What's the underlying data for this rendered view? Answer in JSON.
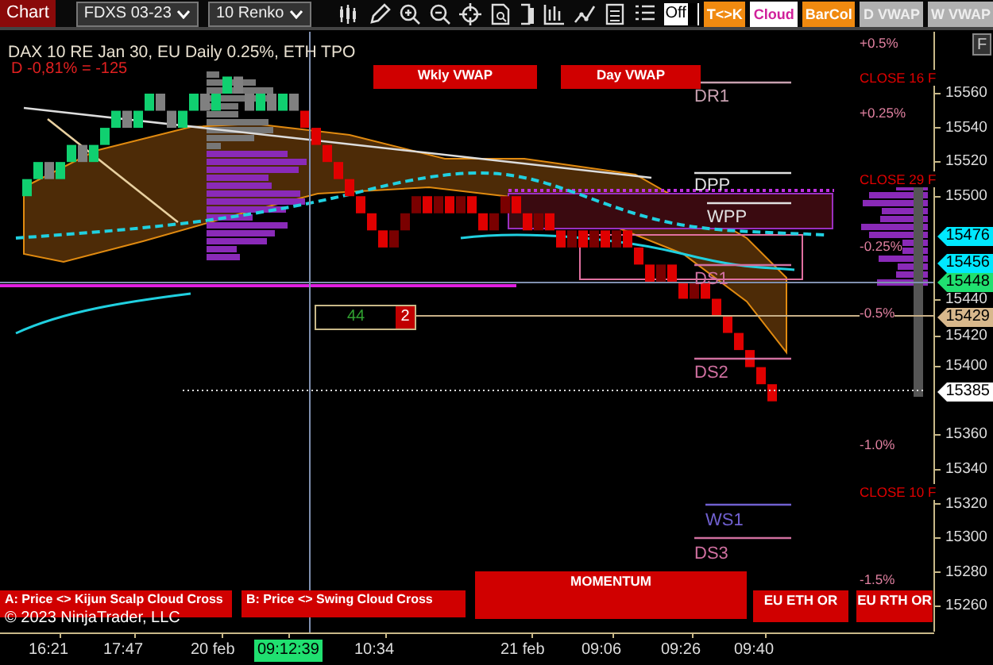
{
  "toolbar": {
    "tab": "Chart",
    "instrument": "FDXS 03-23",
    "bar_type": "10 Renko",
    "toggle": {
      "label": "Off",
      "on": false
    },
    "buttons": [
      {
        "label": "T<>K",
        "kind": "orange"
      },
      {
        "label": "Cloud",
        "kind": "white"
      },
      {
        "label": "BarCol",
        "kind": "orange"
      },
      {
        "label": "D VWAP",
        "kind": "grey"
      },
      {
        "label": "W VWAP",
        "kind": "grey"
      }
    ]
  },
  "chart": {
    "title": "DAX 10  RE Jan 30, EU Daily 0.25%, ETH TPO",
    "change": "D -0,81% = -125",
    "vwap_buttons": [
      "Wkly VWAP",
      "Day VWAP"
    ],
    "pivot_labels": [
      {
        "label": "DR1",
        "color": "#c8a0b0"
      },
      {
        "label": "DPP",
        "color": "#e0e0e0"
      },
      {
        "label": "WPP",
        "color": "#e0e0e0"
      },
      {
        "label": "DS1",
        "color": "#d070a0"
      },
      {
        "label": "DS2",
        "color": "#d070a0"
      },
      {
        "label": "WS1",
        "color": "#7060d0"
      },
      {
        "label": "DS3",
        "color": "#d070a0"
      }
    ],
    "percent_labels": [
      "+0.5%",
      "+0.25%",
      "-0.25%",
      "-0.5%",
      "-1.0%",
      "-1.5%"
    ],
    "close_labels": [
      "CLOSE 16 F",
      "CLOSE 29 F",
      "CLOSE 10 F"
    ],
    "counter": {
      "value": "44",
      "badge": "2"
    },
    "signal_buttons": [
      "A: Price <> Kijun Scalp Cloud Cross",
      "B: Price <> Swing Cloud Cross"
    ],
    "momentum": "MOMENTUM",
    "session_buttons": [
      "EU ETH OR",
      "EU RTH OR"
    ],
    "copyright": "© 2023 NinjaTrader, LLC",
    "corner_button": "F",
    "price_axis": {
      "ticks": [
        "15560",
        "15540",
        "15520",
        "15500",
        "15440",
        "15420",
        "15400",
        "15360",
        "15340",
        "15320",
        "15300",
        "15280",
        "15260"
      ],
      "tags": [
        {
          "value": "15476",
          "color": "#00e8ff"
        },
        {
          "value": "15456",
          "color": "#00e8ff"
        },
        {
          "value": "15448",
          "color": "#20e070"
        },
        {
          "value": "15429",
          "color": "#d8b88c"
        },
        {
          "value": "15385",
          "color": "#ffffff"
        }
      ]
    },
    "time_axis": [
      {
        "label": "16:21",
        "highlighted": false
      },
      {
        "label": "17:47",
        "highlighted": false
      },
      {
        "label": "20 feb",
        "highlighted": false
      },
      {
        "label": "09:12:39",
        "highlighted": true
      },
      {
        "label": "10:34",
        "highlighted": false
      },
      {
        "label": "21 feb",
        "highlighted": false
      },
      {
        "label": "09:06",
        "highlighted": false
      },
      {
        "label": "09:26",
        "highlighted": false
      },
      {
        "label": "09:40",
        "highlighted": false
      }
    ]
  }
}
